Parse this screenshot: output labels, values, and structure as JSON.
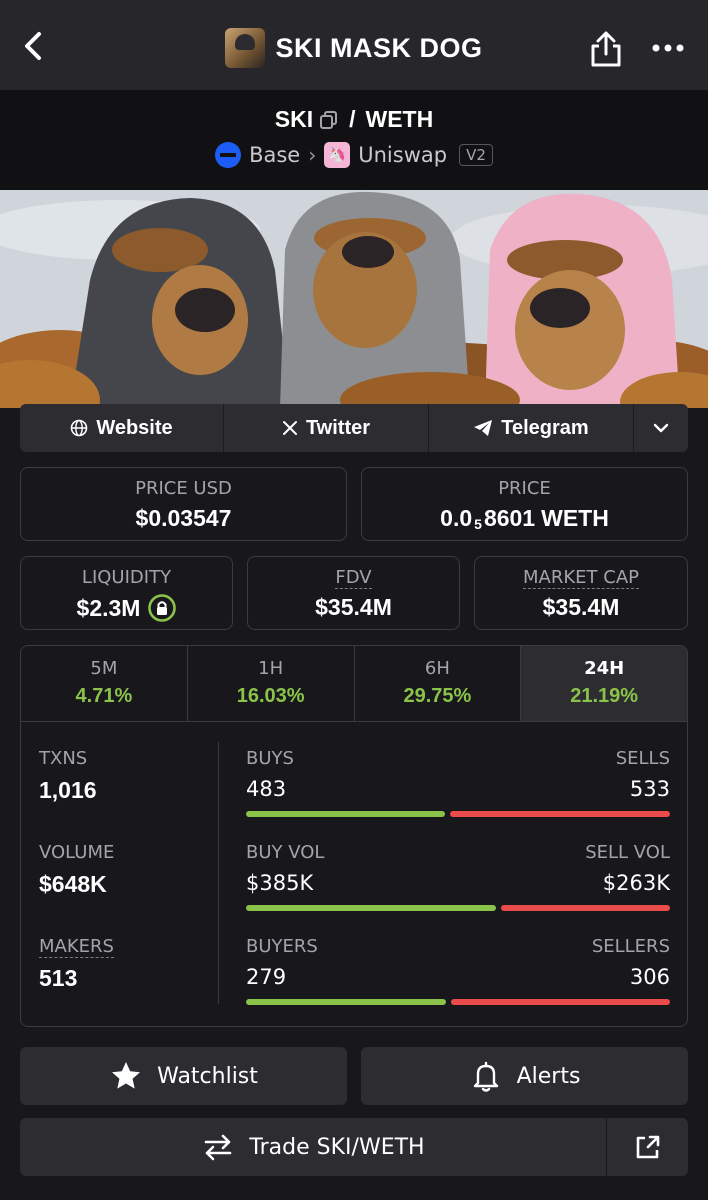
{
  "header": {
    "title": "SKI MASK DOG",
    "icons": {
      "back": "chevron-left-icon",
      "share": "share-icon",
      "more": "more-icon"
    }
  },
  "pair": {
    "base_symbol": "SKI",
    "separator": "/",
    "quote_symbol": "WETH",
    "chain": "Base",
    "dex": "Uniswap",
    "version": "V2"
  },
  "links": {
    "website": "Website",
    "twitter": "Twitter",
    "telegram": "Telegram"
  },
  "price_usd": {
    "label": "PRICE USD",
    "value": "$0.03547"
  },
  "price": {
    "label": "PRICE",
    "prefix": "0.0",
    "subscript": "5",
    "digits": "8601",
    "unit": "WETH"
  },
  "liquidity": {
    "label": "LIQUIDITY",
    "value": "$2.3M"
  },
  "fdv": {
    "label": "FDV",
    "value": "$35.4M"
  },
  "market_cap": {
    "label": "MARKET CAP",
    "value": "$35.4M"
  },
  "timeframes": [
    {
      "label": "5M",
      "change": "4.71%"
    },
    {
      "label": "1H",
      "change": "16.03%"
    },
    {
      "label": "6H",
      "change": "29.75%"
    },
    {
      "label": "24H",
      "change": "21.19%",
      "active": true
    }
  ],
  "stats": {
    "txns": {
      "label": "TXNS",
      "value": "1,016"
    },
    "volume": {
      "label": "VOLUME",
      "value": "$648K"
    },
    "makers": {
      "label": "MAKERS",
      "value": "513"
    },
    "buys_sells": {
      "left_label": "BUYS",
      "right_label": "SELLS",
      "left_value": "483",
      "right_value": "533",
      "buy_fraction": 0.475
    },
    "buy_sell_vol": {
      "left_label": "BUY VOL",
      "right_label": "SELL VOL",
      "left_value": "$385K",
      "right_value": "$263K",
      "buy_fraction": 0.594
    },
    "buyers_sellers": {
      "left_label": "BUYERS",
      "right_label": "SELLERS",
      "left_value": "279",
      "right_value": "306",
      "buy_fraction": 0.477
    }
  },
  "actions": {
    "watchlist": "Watchlist",
    "alerts": "Alerts",
    "trade": "Trade SKI/WETH"
  },
  "colors": {
    "positive": "#8bc34a",
    "negative": "#ea4c4c",
    "lock": "#8bc34a"
  }
}
